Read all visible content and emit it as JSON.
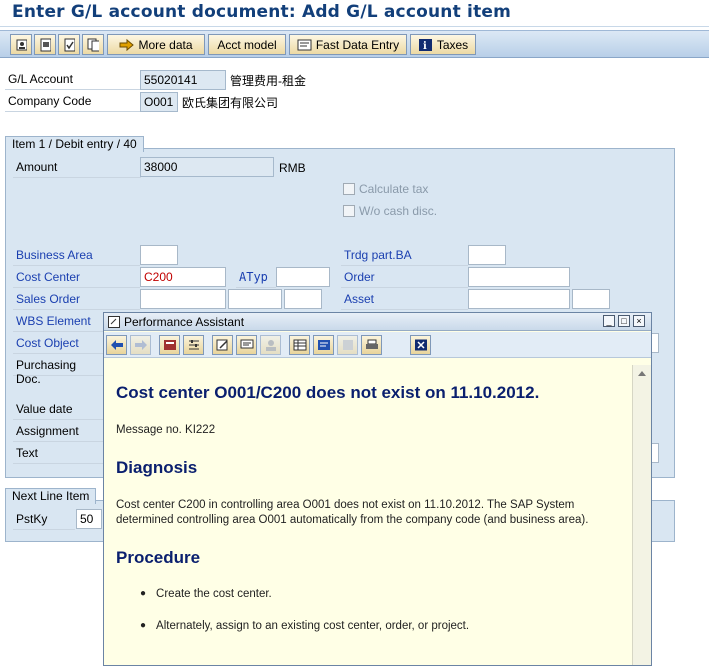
{
  "title": "Enter G/L account document: Add G/L account item",
  "toolbar": {
    "more_data": "More data",
    "acct_model": "Acct model",
    "fast_data_entry": "Fast Data Entry",
    "taxes": "Taxes"
  },
  "header": {
    "gl_account_label": "G/L Account",
    "gl_account_value": "55020141",
    "gl_account_desc": "管理费用-租金",
    "company_code_label": "Company Code",
    "company_code_value": "O001",
    "company_code_desc": "欧氏集团有限公司"
  },
  "item": {
    "tab_label": "Item 1 / Debit entry / 40",
    "amount_label": "Amount",
    "amount_value": "38000",
    "currency": "RMB",
    "calculate_tax": "Calculate tax",
    "wo_cash_disc": "W/o cash disc.",
    "business_area": "Business Area",
    "trdg_part_ba": "Trdg part.BA",
    "cost_center": "Cost Center",
    "cost_center_value": "C200",
    "atyp": "ATyp",
    "order": "Order",
    "sales_order": "Sales Order",
    "asset": "Asset",
    "wbs_element": "WBS Element",
    "cost_object": "Cost Object",
    "purchasing_doc": "Purchasing Doc.",
    "value_date": "Value date",
    "assignment": "Assignment",
    "text": "Text"
  },
  "next_line": {
    "tab_label": "Next Line Item",
    "pstky_label": "PstKy",
    "pstky_value": "50"
  },
  "popup": {
    "title": "Performance Assistant",
    "heading": "Cost center O001/C200 does not exist on 11.10.2012.",
    "message_no": "Message no. KI222",
    "diagnosis_heading": "Diagnosis",
    "diagnosis_text": "Cost center C200 in controlling area O001 does not exist on 11.10.2012. The SAP System determined controlling area O001 automatically from the company code (and business area).",
    "procedure_heading": "Procedure",
    "steps": [
      "Create the cost center.",
      "Alternately, assign to an existing cost center, order, or project."
    ]
  },
  "colors": {
    "title": "#123f7a",
    "panel": "#d9e6f2",
    "popup_bg": "#ffffe6",
    "heading": "#0a1f6e",
    "error_value": "#c00000"
  }
}
